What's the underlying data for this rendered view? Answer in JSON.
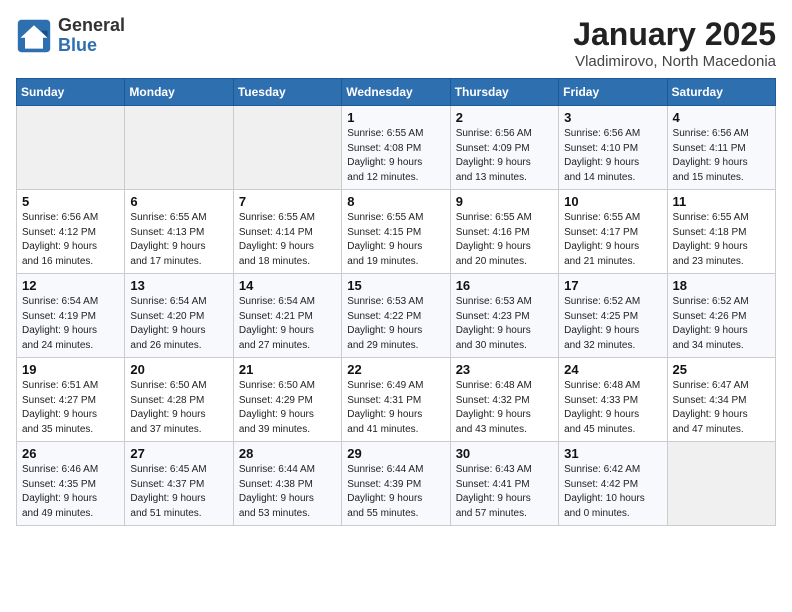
{
  "logo": {
    "general": "General",
    "blue": "Blue"
  },
  "title": "January 2025",
  "subtitle": "Vladimirovo, North Macedonia",
  "days_of_week": [
    "Sunday",
    "Monday",
    "Tuesday",
    "Wednesday",
    "Thursday",
    "Friday",
    "Saturday"
  ],
  "weeks": [
    [
      {
        "day": "",
        "info": ""
      },
      {
        "day": "",
        "info": ""
      },
      {
        "day": "",
        "info": ""
      },
      {
        "day": "1",
        "info": "Sunrise: 6:55 AM\nSunset: 4:08 PM\nDaylight: 9 hours\nand 12 minutes."
      },
      {
        "day": "2",
        "info": "Sunrise: 6:56 AM\nSunset: 4:09 PM\nDaylight: 9 hours\nand 13 minutes."
      },
      {
        "day": "3",
        "info": "Sunrise: 6:56 AM\nSunset: 4:10 PM\nDaylight: 9 hours\nand 14 minutes."
      },
      {
        "day": "4",
        "info": "Sunrise: 6:56 AM\nSunset: 4:11 PM\nDaylight: 9 hours\nand 15 minutes."
      }
    ],
    [
      {
        "day": "5",
        "info": "Sunrise: 6:56 AM\nSunset: 4:12 PM\nDaylight: 9 hours\nand 16 minutes."
      },
      {
        "day": "6",
        "info": "Sunrise: 6:55 AM\nSunset: 4:13 PM\nDaylight: 9 hours\nand 17 minutes."
      },
      {
        "day": "7",
        "info": "Sunrise: 6:55 AM\nSunset: 4:14 PM\nDaylight: 9 hours\nand 18 minutes."
      },
      {
        "day": "8",
        "info": "Sunrise: 6:55 AM\nSunset: 4:15 PM\nDaylight: 9 hours\nand 19 minutes."
      },
      {
        "day": "9",
        "info": "Sunrise: 6:55 AM\nSunset: 4:16 PM\nDaylight: 9 hours\nand 20 minutes."
      },
      {
        "day": "10",
        "info": "Sunrise: 6:55 AM\nSunset: 4:17 PM\nDaylight: 9 hours\nand 21 minutes."
      },
      {
        "day": "11",
        "info": "Sunrise: 6:55 AM\nSunset: 4:18 PM\nDaylight: 9 hours\nand 23 minutes."
      }
    ],
    [
      {
        "day": "12",
        "info": "Sunrise: 6:54 AM\nSunset: 4:19 PM\nDaylight: 9 hours\nand 24 minutes."
      },
      {
        "day": "13",
        "info": "Sunrise: 6:54 AM\nSunset: 4:20 PM\nDaylight: 9 hours\nand 26 minutes."
      },
      {
        "day": "14",
        "info": "Sunrise: 6:54 AM\nSunset: 4:21 PM\nDaylight: 9 hours\nand 27 minutes."
      },
      {
        "day": "15",
        "info": "Sunrise: 6:53 AM\nSunset: 4:22 PM\nDaylight: 9 hours\nand 29 minutes."
      },
      {
        "day": "16",
        "info": "Sunrise: 6:53 AM\nSunset: 4:23 PM\nDaylight: 9 hours\nand 30 minutes."
      },
      {
        "day": "17",
        "info": "Sunrise: 6:52 AM\nSunset: 4:25 PM\nDaylight: 9 hours\nand 32 minutes."
      },
      {
        "day": "18",
        "info": "Sunrise: 6:52 AM\nSunset: 4:26 PM\nDaylight: 9 hours\nand 34 minutes."
      }
    ],
    [
      {
        "day": "19",
        "info": "Sunrise: 6:51 AM\nSunset: 4:27 PM\nDaylight: 9 hours\nand 35 minutes."
      },
      {
        "day": "20",
        "info": "Sunrise: 6:50 AM\nSunset: 4:28 PM\nDaylight: 9 hours\nand 37 minutes."
      },
      {
        "day": "21",
        "info": "Sunrise: 6:50 AM\nSunset: 4:29 PM\nDaylight: 9 hours\nand 39 minutes."
      },
      {
        "day": "22",
        "info": "Sunrise: 6:49 AM\nSunset: 4:31 PM\nDaylight: 9 hours\nand 41 minutes."
      },
      {
        "day": "23",
        "info": "Sunrise: 6:48 AM\nSunset: 4:32 PM\nDaylight: 9 hours\nand 43 minutes."
      },
      {
        "day": "24",
        "info": "Sunrise: 6:48 AM\nSunset: 4:33 PM\nDaylight: 9 hours\nand 45 minutes."
      },
      {
        "day": "25",
        "info": "Sunrise: 6:47 AM\nSunset: 4:34 PM\nDaylight: 9 hours\nand 47 minutes."
      }
    ],
    [
      {
        "day": "26",
        "info": "Sunrise: 6:46 AM\nSunset: 4:35 PM\nDaylight: 9 hours\nand 49 minutes."
      },
      {
        "day": "27",
        "info": "Sunrise: 6:45 AM\nSunset: 4:37 PM\nDaylight: 9 hours\nand 51 minutes."
      },
      {
        "day": "28",
        "info": "Sunrise: 6:44 AM\nSunset: 4:38 PM\nDaylight: 9 hours\nand 53 minutes."
      },
      {
        "day": "29",
        "info": "Sunrise: 6:44 AM\nSunset: 4:39 PM\nDaylight: 9 hours\nand 55 minutes."
      },
      {
        "day": "30",
        "info": "Sunrise: 6:43 AM\nSunset: 4:41 PM\nDaylight: 9 hours\nand 57 minutes."
      },
      {
        "day": "31",
        "info": "Sunrise: 6:42 AM\nSunset: 4:42 PM\nDaylight: 10 hours\nand 0 minutes."
      },
      {
        "day": "",
        "info": ""
      }
    ]
  ]
}
